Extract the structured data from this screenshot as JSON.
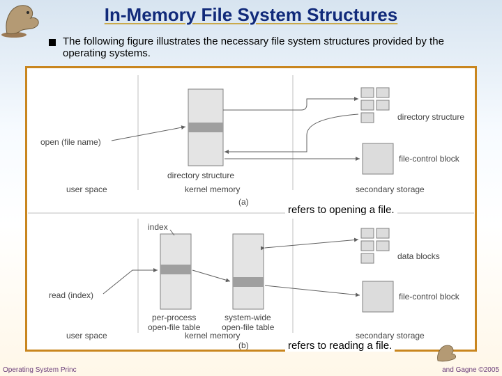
{
  "title": "In-Memory File System Structures",
  "bullet": "The following figure illustrates the necessary file system structures provided by the operating systems.",
  "labels": {
    "open_call": "open (file name)",
    "dir_struct": "directory structure",
    "fcb": "file-control block",
    "user_space": "user space",
    "kernel_memory": "kernel memory",
    "secondary_storage": "secondary storage",
    "fig_a_tag": "(a)",
    "read_call": "read (index)",
    "index": "index",
    "pp_oft": "per-process open-file table",
    "sw_oft": "system-wide open-file table",
    "data_blocks": "data blocks",
    "fig_b_tag": "(b)"
  },
  "captions": {
    "a": "refers to opening a file.",
    "b": "refers to reading a file."
  },
  "footer": {
    "left": "Operating System Princ",
    "right": "and Gagne ©2005"
  }
}
